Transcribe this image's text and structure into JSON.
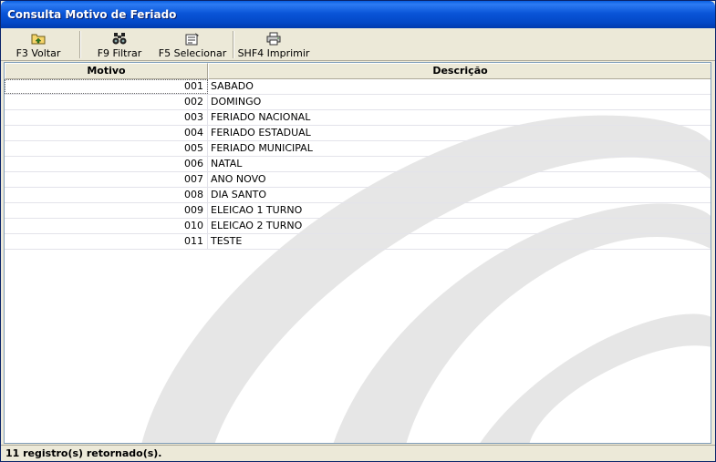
{
  "window": {
    "title": "Consulta Motivo de Feriado"
  },
  "toolbar": {
    "back_label": "F3 Voltar",
    "filter_label": "F9 Filtrar",
    "select_label": "F5 Selecionar",
    "print_label": "SHF4 Imprimir"
  },
  "grid": {
    "columns": [
      "Motivo",
      "Descrição"
    ],
    "rows": [
      {
        "motivo": "001",
        "descricao": "SABADO"
      },
      {
        "motivo": "002",
        "descricao": "DOMINGO"
      },
      {
        "motivo": "003",
        "descricao": "FERIADO NACIONAL"
      },
      {
        "motivo": "004",
        "descricao": "FERIADO ESTADUAL"
      },
      {
        "motivo": "005",
        "descricao": "FERIADO MUNICIPAL"
      },
      {
        "motivo": "006",
        "descricao": "NATAL"
      },
      {
        "motivo": "007",
        "descricao": "ANO NOVO"
      },
      {
        "motivo": "008",
        "descricao": "DIA SANTO"
      },
      {
        "motivo": "009",
        "descricao": "ELEICAO 1 TURNO"
      },
      {
        "motivo": "010",
        "descricao": "ELEICAO 2 TURNO"
      },
      {
        "motivo": "011",
        "descricao": "TESTE"
      }
    ]
  },
  "status": {
    "text": "11 registro(s) retornado(s)."
  },
  "icons": {
    "back": "folder-back-icon",
    "filter": "binoculars-icon",
    "select": "select-form-icon",
    "print": "printer-icon"
  },
  "colors": {
    "titlebar": "#0a55d8",
    "face": "#ece9d8",
    "watermark": "#e6e6e6"
  }
}
